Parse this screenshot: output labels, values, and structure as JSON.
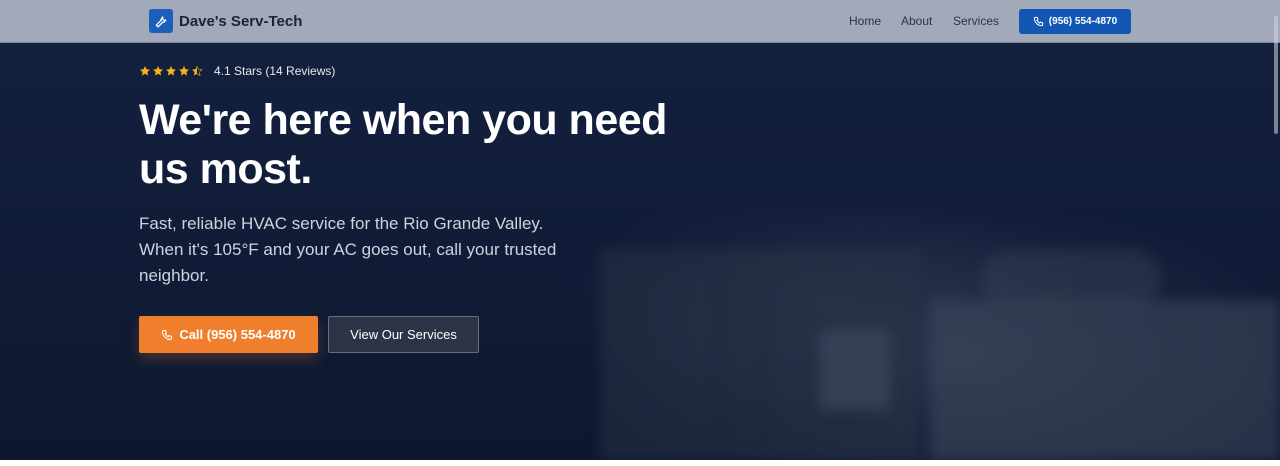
{
  "header": {
    "brand": "Dave's Serv-Tech",
    "brand_icon": "wrench-icon",
    "nav": [
      {
        "label": "Home"
      },
      {
        "label": "About"
      },
      {
        "label": "Services"
      }
    ],
    "call_button": {
      "label": "(956) 554-4870",
      "icon": "phone-icon"
    }
  },
  "hero": {
    "rating": {
      "value": 4.1,
      "max": 5,
      "text": "4.1 Stars (14 Reviews)"
    },
    "title": "We're here when you need us most.",
    "subtitle": "Fast, reliable HVAC service for the Rio Grande Valley. When it's 105°F and your AC goes out, call your trusted neighbor.",
    "primary_button": {
      "label": "Call (956) 554-4870",
      "icon": "phone-icon"
    },
    "secondary_button": {
      "label": "View Our Services"
    }
  },
  "colors": {
    "accent_orange": "#ef7f2d",
    "brand_blue": "#1357b5",
    "star_yellow": "#f6b21a",
    "hero_bg": "#12203d"
  }
}
